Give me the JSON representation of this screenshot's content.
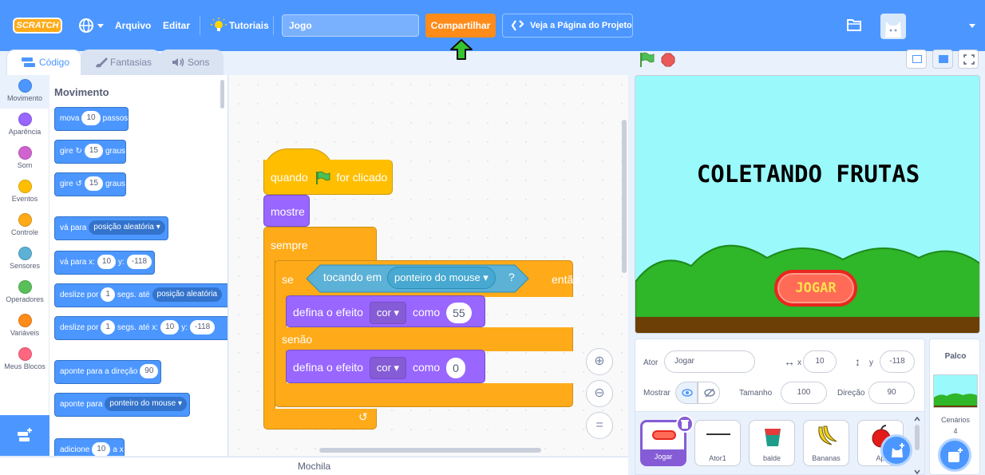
{
  "menubar": {
    "logo_text": "SCRATCH",
    "file_label": "Arquivo",
    "edit_label": "Editar",
    "tutorials_label": "Tutoriais",
    "project_title": "Jogo",
    "share_label": "Compartilhar",
    "project_page_label": "Veja a Página do Projeto"
  },
  "tabs": {
    "code": "Código",
    "costumes": "Fantasias",
    "sounds": "Sons"
  },
  "categories": [
    {
      "label": "Movimento",
      "color": "#4c97ff"
    },
    {
      "label": "Aparência",
      "color": "#9966ff"
    },
    {
      "label": "Som",
      "color": "#cf63cf"
    },
    {
      "label": "Eventos",
      "color": "#ffbf00"
    },
    {
      "label": "Controle",
      "color": "#ffab19"
    },
    {
      "label": "Sensores",
      "color": "#5cb1d6"
    },
    {
      "label": "Operadores",
      "color": "#59c059"
    },
    {
      "label": "Variáveis",
      "color": "#ff8c1a"
    },
    {
      "label": "Meus Blocos",
      "color": "#ff6680"
    }
  ],
  "palette": {
    "title": "Movimento",
    "move": {
      "text": "mova",
      "value": "10",
      "suffix": "passos"
    },
    "turn_right": {
      "text": "gire",
      "value": "15",
      "suffix": "graus"
    },
    "turn_left": {
      "text": "gire",
      "value": "15",
      "suffix": "graus"
    },
    "goto": {
      "text": "vá para",
      "option": "posição aleatória"
    },
    "goto_xy": {
      "text": "vá para x:",
      "x": "10",
      "ylabel": "y:",
      "y": "-118"
    },
    "glide": {
      "text": "deslize por",
      "value": "1",
      "mid": "segs. até",
      "option": "posição aleatória"
    },
    "glide_xy": {
      "text": "deslize por",
      "value": "1",
      "mid": "segs. até x:",
      "x": "10",
      "ylabel": "y:",
      "y": "-118"
    },
    "point_dir": {
      "text": "aponte para a direção",
      "value": "90"
    },
    "point_to": {
      "text": "aponte para",
      "option": "ponteiro do mouse"
    },
    "change_x": {
      "text": "adicione",
      "value": "10",
      "suffix": "a x"
    }
  },
  "script": {
    "hat": {
      "before": "quando",
      "after": "for clicado"
    },
    "show": "mostre",
    "forever": "sempre",
    "if_label": "se",
    "touching": {
      "text": "tocando em",
      "option": "ponteiro do mouse",
      "q": "?"
    },
    "then": "então",
    "set_effect_1": {
      "text": "defina o efeito",
      "option": "cor",
      "mid": "como",
      "value": "55"
    },
    "else_label": "senão",
    "set_effect_2": {
      "text": "defina o efeito",
      "option": "cor",
      "mid": "como",
      "value": "0"
    }
  },
  "backpack": "Mochila",
  "stage": {
    "game_title": "COLETANDO FRUTAS",
    "play_button": "JOGAR"
  },
  "sprite_info": {
    "sprite_label": "Ator",
    "sprite_name": "Jogar",
    "x_label": "x",
    "x": "10",
    "y_label": "y",
    "y": "-118",
    "show_label": "Mostrar",
    "size_label": "Tamanho",
    "size": "100",
    "direction_label": "Direção",
    "direction": "90"
  },
  "sprites": [
    {
      "name": "Jogar"
    },
    {
      "name": "Ator1"
    },
    {
      "name": "balde"
    },
    {
      "name": "Bananas"
    },
    {
      "name": "Ap"
    }
  ],
  "stage_target": {
    "title": "Palco",
    "backdrops_label": "Cenários",
    "backdrop_count": "4"
  }
}
